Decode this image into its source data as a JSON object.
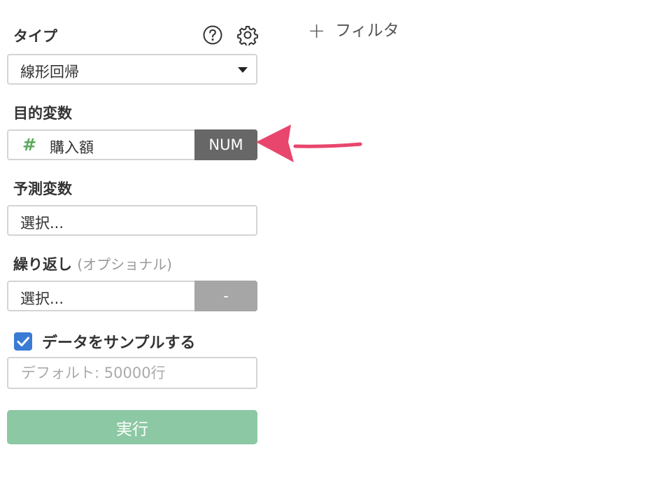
{
  "type_section": {
    "label": "タイプ",
    "help_icon": "question-circle-icon",
    "settings_icon": "gear-icon",
    "selected": "線形回帰"
  },
  "target_section": {
    "label": "目的変数",
    "column_icon": "#",
    "column_icon_color": "#5aa95a",
    "column_name": "購入額",
    "type_tag": "NUM"
  },
  "predictor_section": {
    "label": "予測変数",
    "placeholder": "選択..."
  },
  "repeat_section": {
    "label": "繰り返し",
    "optional": "(オプショナル)",
    "placeholder": "選択...",
    "side_tag": "-"
  },
  "sample_section": {
    "checked": true,
    "checkbox_color": "#3a7bd5",
    "label": "データをサンプルする",
    "input_placeholder": "デフォルト: 50000行"
  },
  "run_button": {
    "label": "実行",
    "color": "#8cc8a3"
  },
  "filter": {
    "plus": "+",
    "label": "フィルタ"
  },
  "annotation": {
    "arrow_color": "#e8466d",
    "icon": "pink-arrow-pointer"
  }
}
